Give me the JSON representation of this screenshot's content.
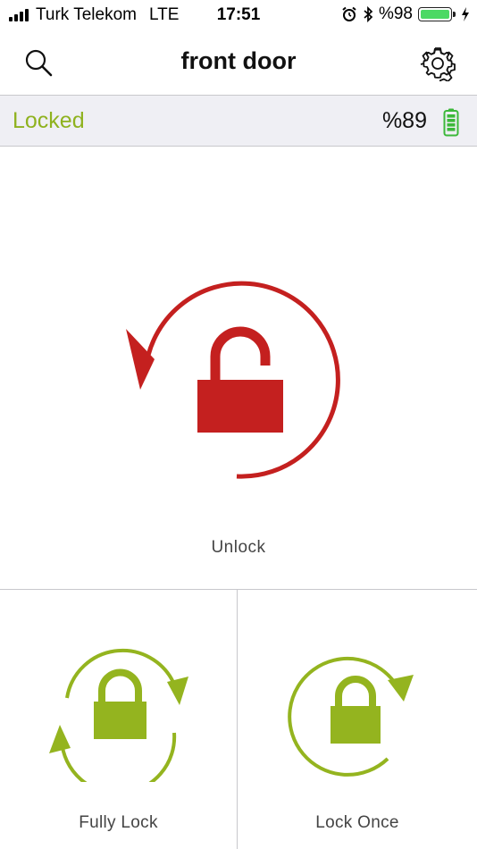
{
  "status_bar": {
    "carrier": "Turk Telekom",
    "network": "LTE",
    "time": "17:51",
    "battery_pct": "%98",
    "icons": [
      "signal-icon",
      "alarm-icon",
      "bluetooth-icon",
      "battery-icon",
      "charging-icon"
    ]
  },
  "nav": {
    "title": "front door",
    "left_icon": "search-icon",
    "right_icon": "gear-icon"
  },
  "lock_status": {
    "state": "Locked",
    "battery": "%89",
    "battery_level": 0.89,
    "state_color": "#8fb21f"
  },
  "actions": {
    "unlock": {
      "label": "Unlock",
      "color": "#c4201f",
      "icon": "unlock-rotate-icon"
    },
    "fully_lock": {
      "label": "Fully Lock",
      "color": "#94b41f",
      "icon": "lock-double-rotate-icon"
    },
    "lock_once": {
      "label": "Lock Once",
      "color": "#94b41f",
      "icon": "lock-rotate-icon"
    }
  }
}
